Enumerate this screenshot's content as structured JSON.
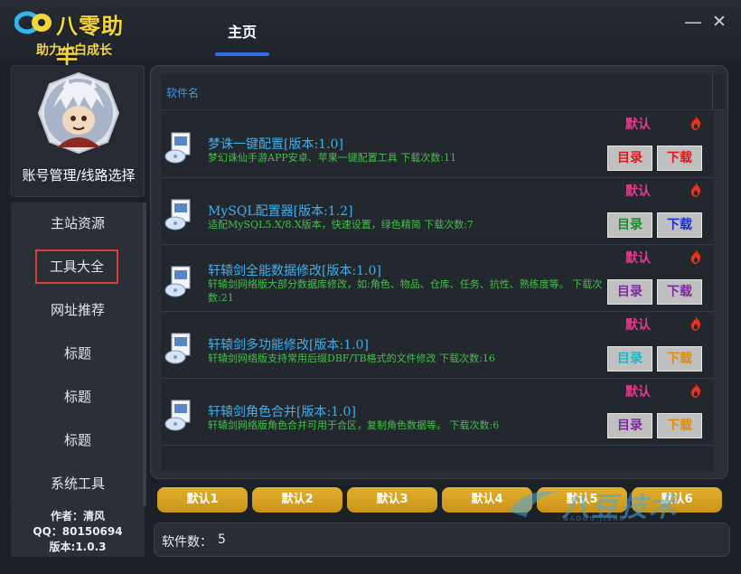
{
  "app": {
    "name": "八零助手",
    "tagline": "助力小白成长",
    "nav_tab": "主页"
  },
  "window": {
    "minimize_glyph": "—",
    "close_glyph": "✕"
  },
  "sidebar": {
    "account_label": "账号管理/线路选择",
    "items": [
      {
        "label": "主站资源",
        "selected": false
      },
      {
        "label": "工具大全",
        "selected": true
      },
      {
        "label": "网址推荐",
        "selected": false
      },
      {
        "label": "标题",
        "selected": false
      },
      {
        "label": "标题",
        "selected": false
      },
      {
        "label": "标题",
        "selected": false
      },
      {
        "label": "系统工具",
        "selected": false
      }
    ],
    "about": {
      "author": "作者：清风",
      "qq": "QQ：80150694",
      "version": "版本:1.0.3"
    }
  },
  "list": {
    "column_header": "软件名",
    "rows": [
      {
        "title": "梦诛一键配置[版本:1.0]",
        "desc": "梦幻诛仙手游APP安卓、苹果一键配置工具 下载次数:11",
        "default": "默认",
        "dir_label": "目录",
        "dir_color": "#e0161c",
        "dl_label": "下载",
        "dl_color": "#e0161c"
      },
      {
        "title": "MySQL配置器[版本:1.2]",
        "desc": "适配MySQL5.X/8.X版本，快速设置，绿色精简 下载次数:7",
        "default": "默认",
        "dir_label": "目录",
        "dir_color": "#1a8a2a",
        "dl_label": "下载",
        "dl_color": "#1a2fd4"
      },
      {
        "title": "轩辕剑全能数据修改[版本:1.0]",
        "desc": "轩辕剑网络版大部分数据库修改，如:角色、物品、仓库、任务、抗性、熟练度等。 下载次数:21",
        "default": "默认",
        "dir_label": "目录",
        "dir_color": "#7b2a9e",
        "dl_label": "下载",
        "dl_color": "#7b2a9e"
      },
      {
        "title": "轩辕剑多功能修改[版本:1.0]",
        "desc": "轩辕剑网络版支持常用后缀DBF/TB格式的文件修改 下载次数:16",
        "default": "默认",
        "dir_label": "目录",
        "dir_color": "#18b8c8",
        "dl_label": "下载",
        "dl_color": "#e08a10"
      },
      {
        "title": "轩辕剑角色合并[版本:1.0]",
        "desc": "轩辕剑网络版角色合并可用于合区，复制角色数据等。 下载次数:6",
        "default": "默认",
        "dir_label": "目录",
        "dir_color": "#7b2a9e",
        "dl_label": "下载",
        "dl_color": "#e08a10"
      }
    ]
  },
  "bottom_buttons": [
    "默认1",
    "默认2",
    "默认3",
    "默认4",
    "默认5",
    "默认6"
  ],
  "status": {
    "label": "软件数：",
    "value": "5"
  },
  "watermark": {
    "text": "八豆技术",
    "en": "BADOU JISHU"
  },
  "colors": {
    "accent": "#2f6ff0",
    "gold": "#f2d63a",
    "title_blue": "#3eb0ee",
    "desc_green": "#43c04a",
    "tag_pink": "#e23a8c",
    "selected_border": "#e03a3a"
  },
  "icons": {
    "logo": "logo-mark",
    "avatar": "avatar-image",
    "app": "software-box-icon",
    "hot": "fire-icon"
  }
}
